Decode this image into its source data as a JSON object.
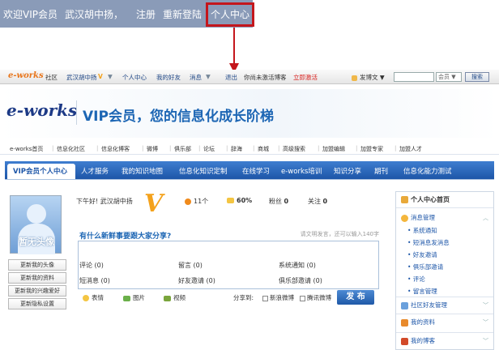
{
  "top_crop": {
    "greeting": "欢迎VIP会员",
    "username": "武汉胡中扬，",
    "register": "注册",
    "relogin": "重新登陆",
    "personal_center": "个人中心"
  },
  "site_toolbar": {
    "logo_main": "e-works",
    "logo_sub": "社区",
    "username": "武汉胡中扬",
    "personal_center": "个人中心",
    "my_friends": "我的好友",
    "messages": "消息",
    "logout": "退出",
    "not_activated": "你尚未激活博客",
    "activate_now": "立即激活",
    "post_blog": "发博文",
    "search_scope": "会员",
    "search_button": "搜索"
  },
  "banner": {
    "logo": "e-works",
    "slogan": "VIP会员，您的信息化成长阶梯"
  },
  "link_nav": [
    "e-works首页",
    "信息化社区",
    "信息化博客",
    "微博",
    "俱乐部",
    "论坛",
    "辞海",
    "商城",
    "高级搜索",
    "加盟编辑",
    "加盟专家",
    "加盟人才"
  ],
  "main_nav": {
    "active": "VIP会员个人中心",
    "items": [
      "人才服务",
      "我的知识地图",
      "信息化知识定制",
      "在线学习",
      "e-works培训",
      "知识分享",
      "期刊",
      "信息化能力测试"
    ]
  },
  "profile": {
    "avatar_text": "暂无头像",
    "buttons": [
      "更新我的头像",
      "更新我的资料",
      "更新我的兴趣爱好",
      "更新隐私设置"
    ]
  },
  "status": {
    "greeting": "下午好! 武汉胡中扬",
    "vip_badge": "V",
    "coins": "11个",
    "completion": "60%",
    "fans_label": "粉丝",
    "fans": "0",
    "follow_label": "关注",
    "follow": "0"
  },
  "post": {
    "prompt": "有什么新鲜事要跟大家分享?",
    "hint": "请文明发言，还可以输入140字",
    "emoji": "表情",
    "image": "图片",
    "video": "视频",
    "share_to": "分享到:",
    "share_sina": "新浪微博",
    "share_qq": "腾讯微博",
    "publish": "发 布"
  },
  "stats": [
    {
      "label": "评论",
      "value": "(0)"
    },
    {
      "label": "留言",
      "value": "(0)"
    },
    {
      "label": "系统通知",
      "value": "(0)"
    },
    {
      "label": "短消息",
      "value": "(0)"
    },
    {
      "label": "好友邀请",
      "value": "(0)"
    },
    {
      "label": "俱乐部邀请",
      "value": "(0)"
    }
  ],
  "sidebar": {
    "home": "个人中心首页",
    "message_mgmt": "消息管理",
    "message_items": [
      "系统通知",
      "短消息发消息",
      "好友邀请",
      "俱乐部邀请",
      "评论",
      "留言管理"
    ],
    "friend_mgmt": "社区好友管理",
    "my_profile": "我的资料",
    "my_blog": "我的博客"
  },
  "colors": {
    "highlight": "#c4161c",
    "nav_blue": "#1d56a8",
    "accent_orange": "#f4a21c"
  }
}
